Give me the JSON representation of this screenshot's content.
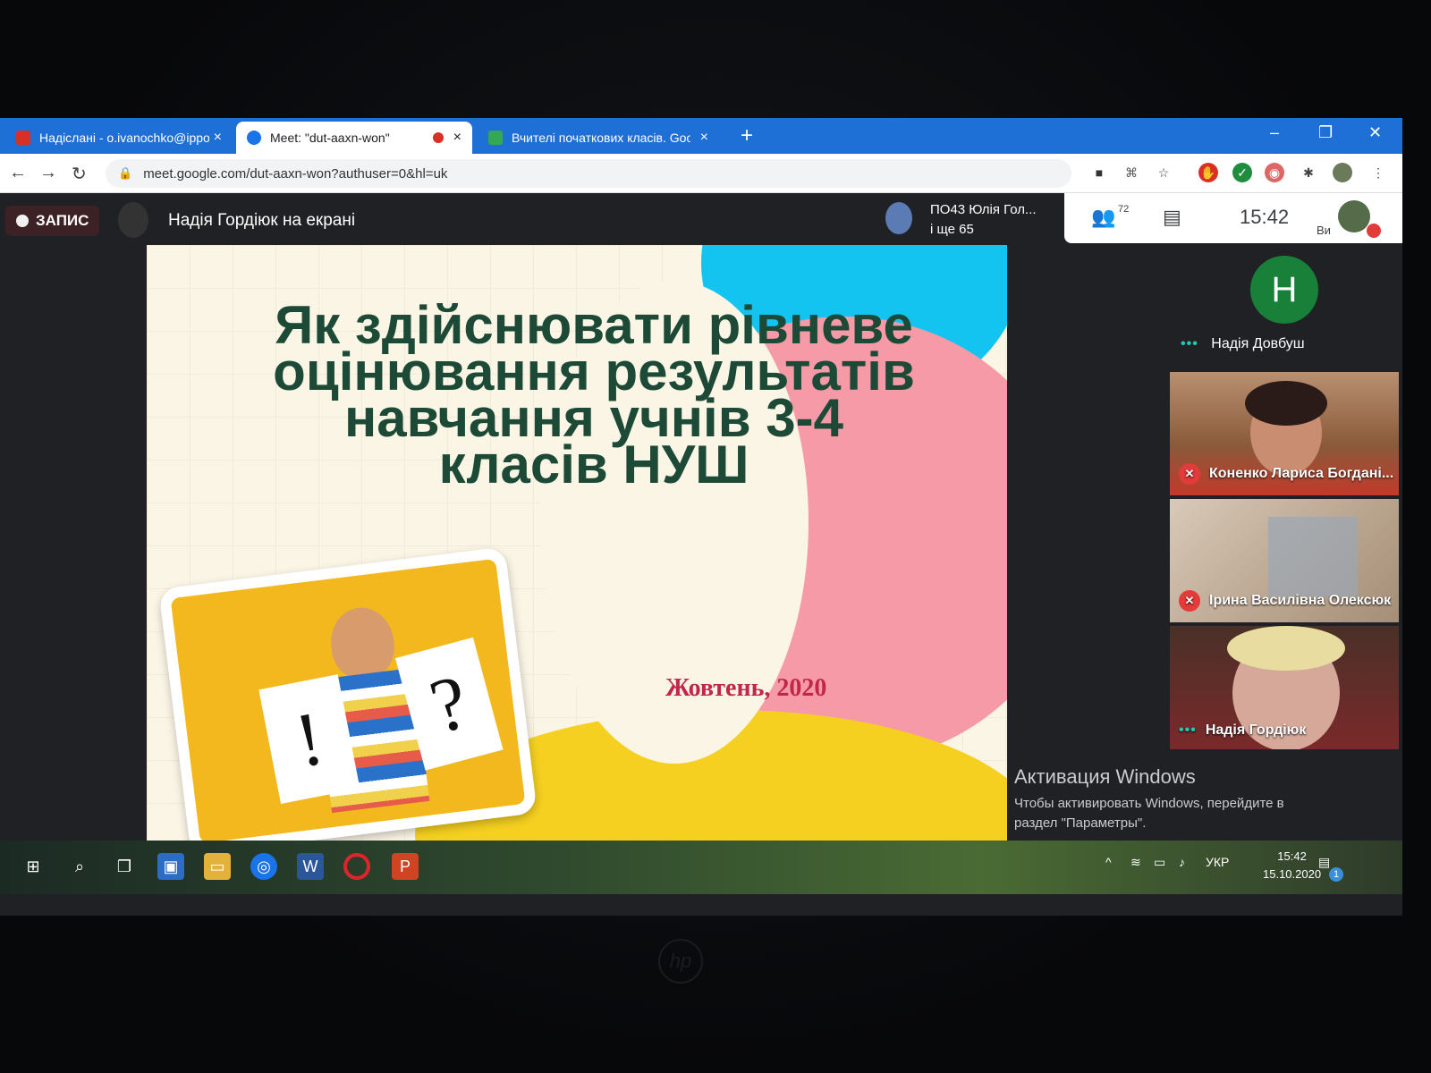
{
  "browser": {
    "tabs": [
      {
        "title": "Надіслані - o.ivanochko@ippo.",
        "close": "×"
      },
      {
        "title": "Meet: \"dut-aaxn-won\"",
        "close": "×"
      },
      {
        "title": "Вчителі початкових класів. Goo",
        "close": "×"
      }
    ],
    "new_tab": "+",
    "window_controls": [
      "–",
      "❐",
      "✕"
    ],
    "url": "meet.google.com/dut-aaxn-won?authuser=0&hl=uk"
  },
  "meet": {
    "recording_label": "ЗАПИС",
    "presenting_text": "Надія Гордіюк на екрані",
    "collaborators": {
      "line1": "ПО43 Юлія Гол...",
      "line2": "і ще 65"
    },
    "participants_count": "72",
    "time": "15:42",
    "self_label": "Ви"
  },
  "slide": {
    "title_lines": [
      "Як здійснювати рівневе",
      "оцінювання результатів",
      "навчання учнів 3-4",
      "класів НУШ"
    ],
    "date": "Жовтень, 2020",
    "paper_left": "!",
    "paper_right": "?"
  },
  "participants": [
    {
      "name": "Надія Довбуш",
      "avatar_letter": "Н"
    },
    {
      "name": "Коненко Лариса Богдані..."
    },
    {
      "name": "Ірина Василівна Олексюк"
    },
    {
      "name": "Надія Гордіюк"
    }
  ],
  "activation": {
    "heading": "Активация Windows",
    "line1": "Чтобы активировать Windows, перейдите в",
    "line2": "раздел \"Параметры\"."
  },
  "taskbar": {
    "language": "УКР",
    "clock_time": "15:42",
    "clock_date": "15.10.2020",
    "notification_count": "1"
  },
  "colors": {
    "accent": "#1e6fd6",
    "meet_bg": "#202124",
    "avatar_green": "#188038",
    "slide_title": "#1d4a36",
    "slide_date": "#c0274b"
  }
}
